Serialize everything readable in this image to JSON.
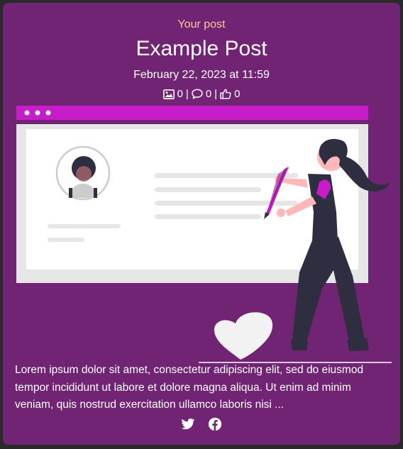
{
  "post": {
    "kicker": "Your post",
    "title": "Example Post",
    "date": "February 22, 2023 at 11:59",
    "stats": {
      "images": "0",
      "comments": "0",
      "likes": "0",
      "separator": "|"
    },
    "excerpt": "Lorem ipsum dolor sit amet, consectetur adipiscing elit, sed do eiusmod tempor incididunt ut labore et dolore magna aliqua. Ut enim ad minim veniam, quis nostrud exercitation ullamco laboris nisi ..."
  },
  "social": {
    "icons": [
      "twitter-icon",
      "facebook-icon"
    ]
  },
  "colors": {
    "card_bg": "#722474",
    "kicker": "#f3cd8d",
    "accent": "#c71cc9",
    "text": "#ffffff"
  }
}
